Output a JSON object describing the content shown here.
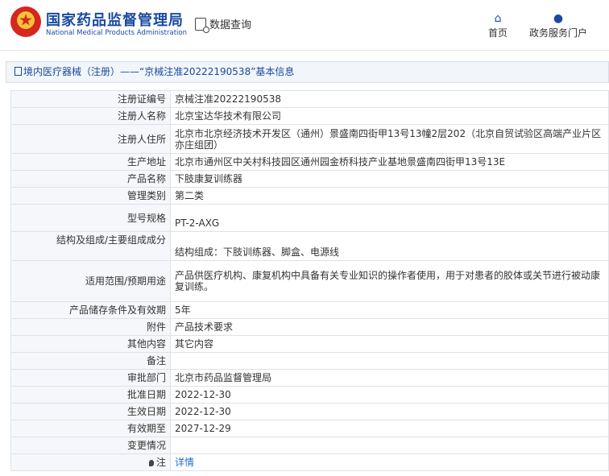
{
  "header": {
    "brand_cn": "国家药品监督管理局",
    "brand_en": "National Medical Products Administration",
    "query_label": "数据查询",
    "nav_home": "首页",
    "nav_portal": "政务服务门户"
  },
  "breadcrumb": "境内医疗器械（注册）——“京械注准20222190538”基本信息",
  "rows": [
    {
      "key": "注册证编号",
      "value": "京械注准20222190538"
    },
    {
      "key": "注册人名称",
      "value": "北京宝达华技术有限公司"
    },
    {
      "key": "注册人住所",
      "value": "北京市北京经济技术开发区（通州）景盛南四街甲13号13幢2层202（北京自贸试验区高端产业片区亦庄组团）"
    },
    {
      "key": "生产地址",
      "value": "北京市通州区中关村科技园区通州园金桥科技产业基地景盛南四街甲13号13E"
    },
    {
      "key": "产品名称",
      "value": "下肢康复训练器"
    },
    {
      "key": "管理类别",
      "value": "第二类"
    },
    {
      "key": "型号规格",
      "value": "PT-2-AXG"
    },
    {
      "key": "结构及组成/主要组成成分",
      "value": "结构组成：下肢训练器、脚盒、电源线"
    },
    {
      "key": "适用范围/预期用途",
      "value": "产品供医疗机构、康复机构中具备有关专业知识的操作者使用，用于对患者的胶体或关节进行被动康复训练。"
    },
    {
      "key": "产品储存条件及有效期",
      "value": "5年"
    },
    {
      "key": "附件",
      "value": "产品技术要求"
    },
    {
      "key": "其他内容",
      "value": "其它内容"
    },
    {
      "key": "备注",
      "value": ""
    },
    {
      "key": "审批部门",
      "value": "北京市药品监督管理局"
    },
    {
      "key": "批准日期",
      "value": "2022-12-30"
    },
    {
      "key": "生效日期",
      "value": "2022-12-30"
    },
    {
      "key": "有效期至",
      "value": "2027-12-29"
    },
    {
      "key": "变更情况",
      "value": ""
    },
    {
      "key": "注",
      "value": "详情"
    }
  ]
}
